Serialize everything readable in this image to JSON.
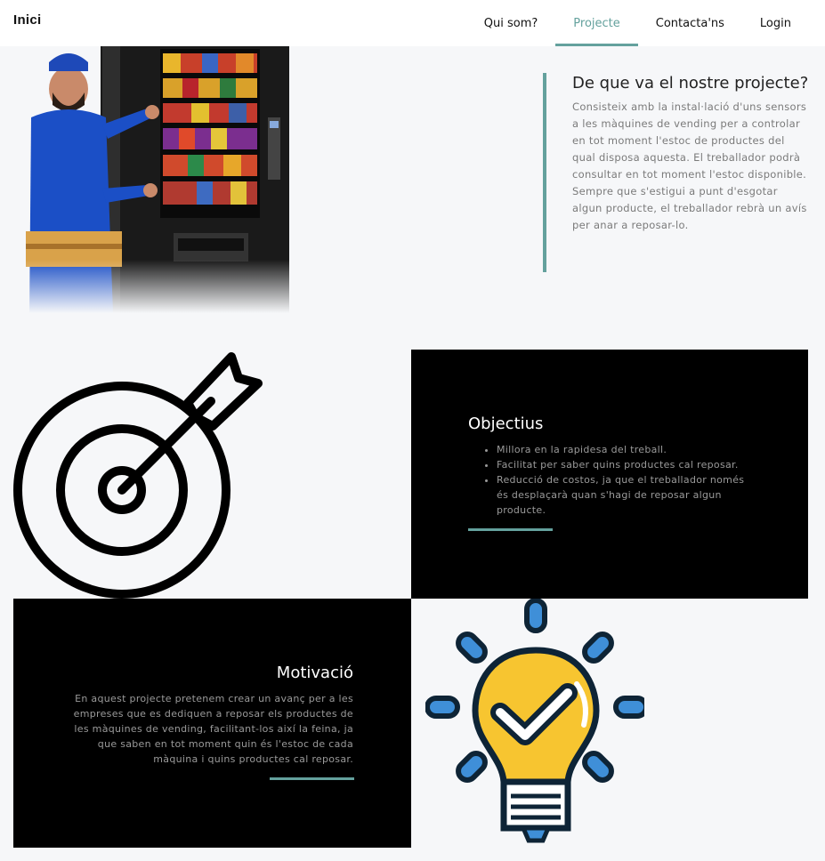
{
  "navbar": {
    "brand": "Inici",
    "links": [
      {
        "label": "Qui som?",
        "active": false
      },
      {
        "label": "Projecte",
        "active": true
      },
      {
        "label": "Contacta'ns",
        "active": false
      },
      {
        "label": "Login",
        "active": false
      }
    ]
  },
  "project": {
    "title": "De que va el nostre projecte?",
    "text": "Consisteix amb la instal·lació d'uns sensors a les màquines de vending per a controlar en tot moment l'estoc de productes del qual disposa aquesta. El treballador podrà consultar en tot moment l'estoc disponible. Sempre que s'estigui a punt d'esgotar algun producte, el treballador rebrà un avís per anar a reposar-lo."
  },
  "objectius": {
    "title": "Objectius",
    "items": [
      "Millora en la rapidesa del treball.",
      "Facilitat per saber quins productes cal reposar.",
      "Reducció de costos, ja que el treballador només és desplaçarà quan s'hagi de reposar algun producte."
    ]
  },
  "motivacio": {
    "title": "Motivació",
    "text": "En aquest projecte pretenem crear un avanç per a les empreses que es dediquen a reposar els productes de les màquines de vending, facilitant-los així la feina, ja que saben en tot moment quin és l'estoc de cada màquina i quins productes cal reposar."
  },
  "colors": {
    "accent": "#64a19d",
    "panel": "#000000",
    "background": "#f6f7f9"
  },
  "icons": [
    "vending-machine-worker-image",
    "target-arrow-icon",
    "lightbulb-check-icon"
  ]
}
